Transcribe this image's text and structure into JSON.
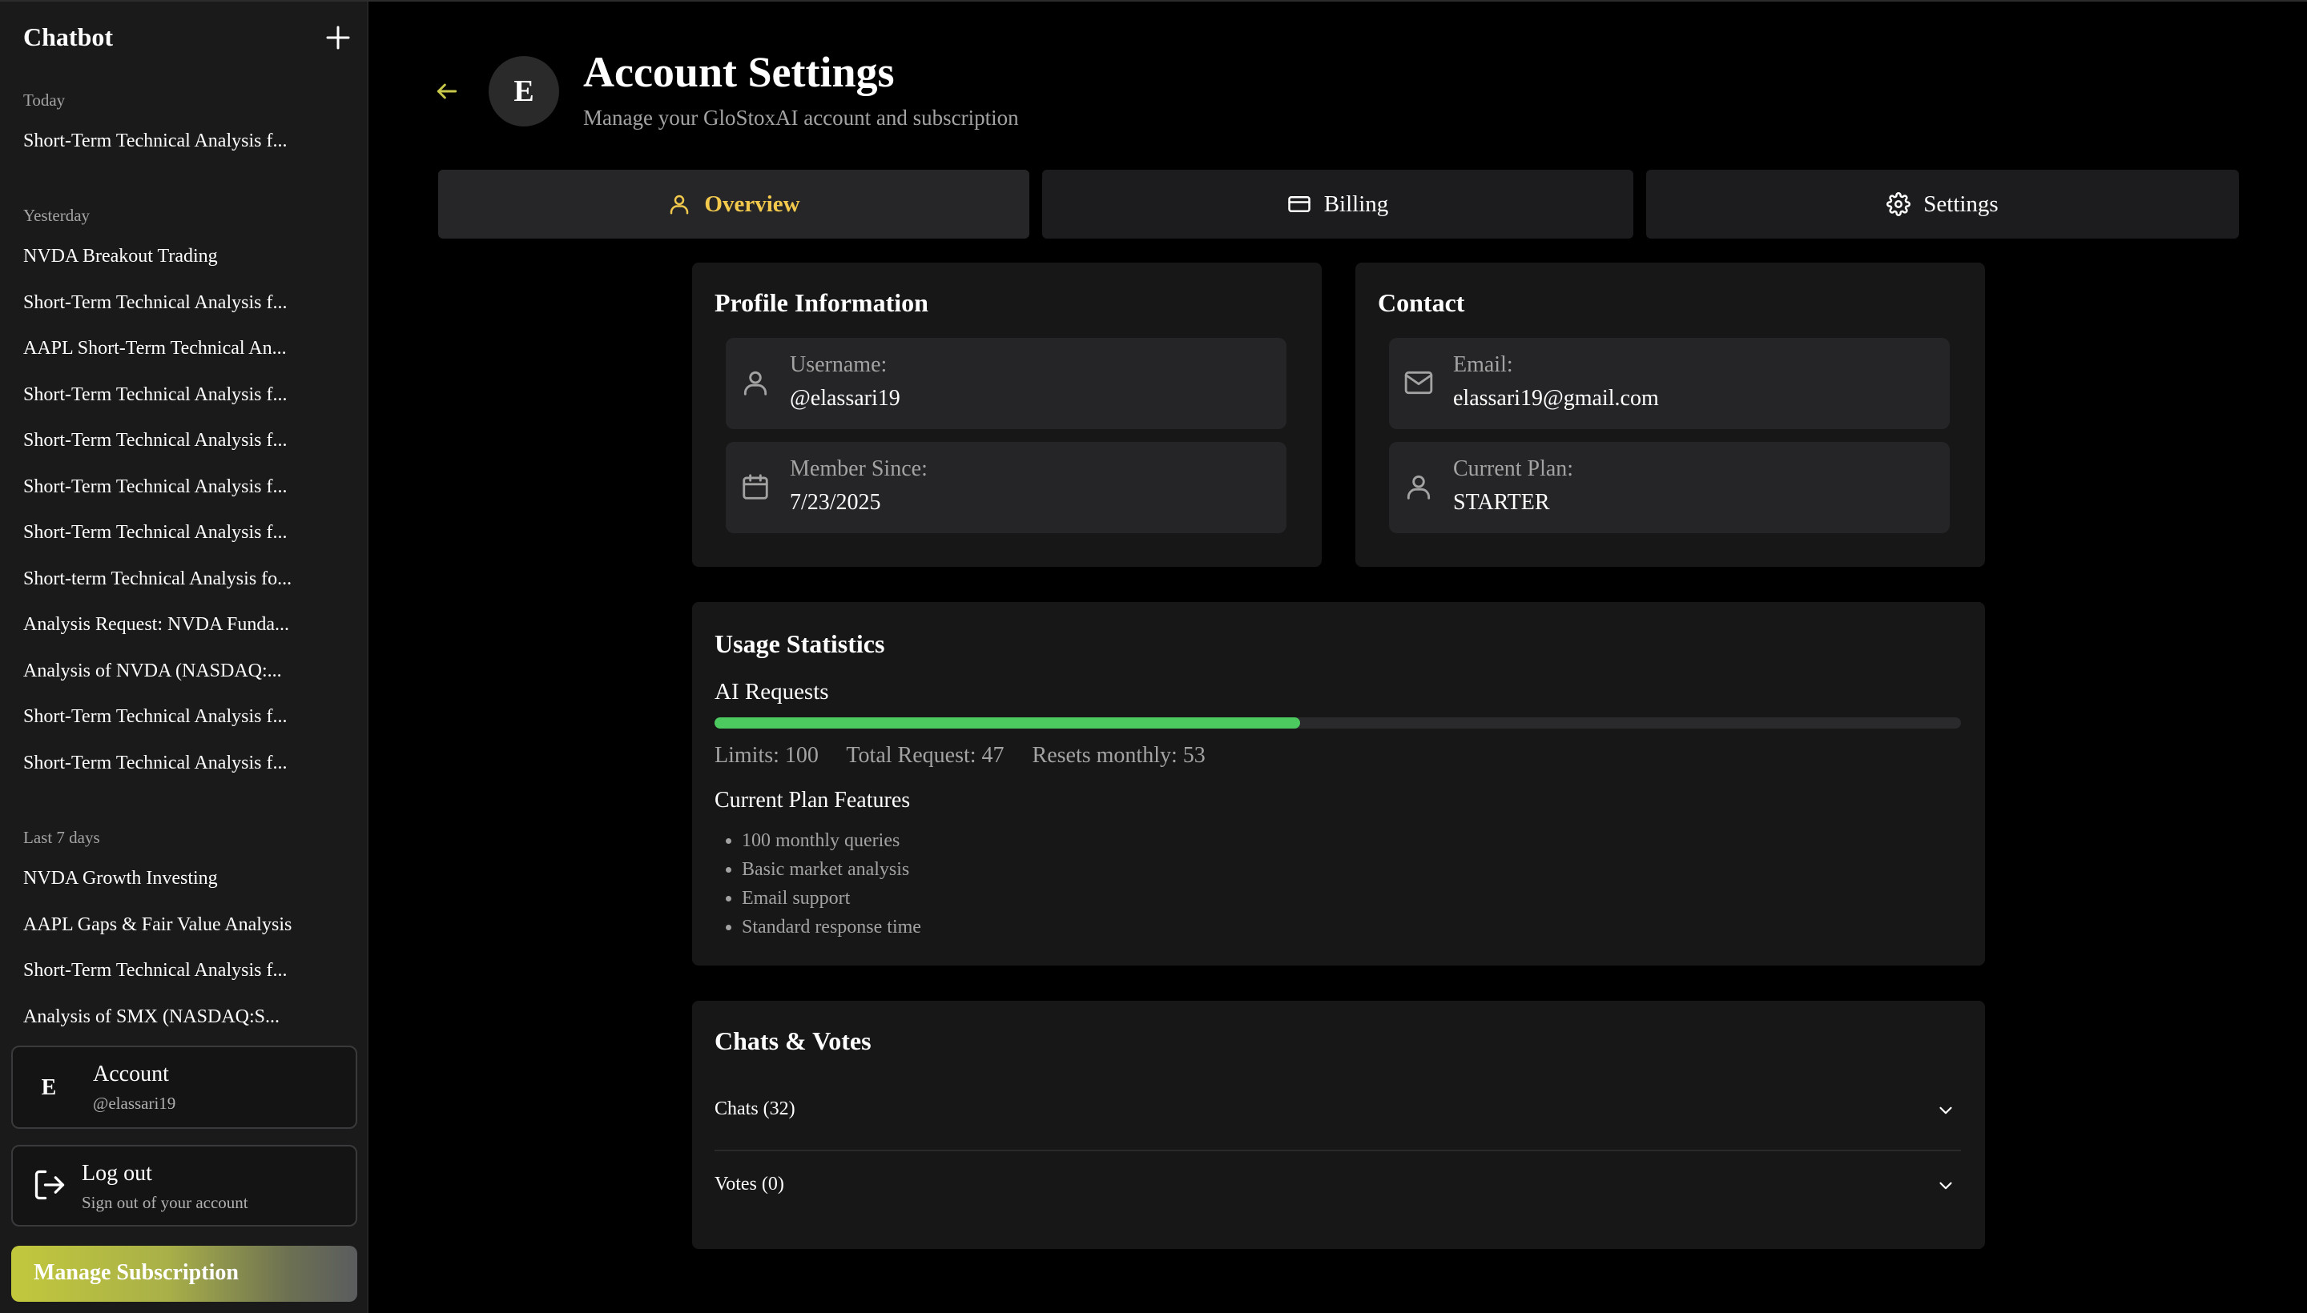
{
  "sidebar": {
    "title": "Chatbot",
    "groups": [
      {
        "label": "Today",
        "items": [
          "Short-Term Technical Analysis f..."
        ]
      },
      {
        "label": "Yesterday",
        "items": [
          "NVDA Breakout Trading",
          "Short-Term Technical Analysis f...",
          "AAPL Short-Term Technical An...",
          "Short-Term Technical Analysis f...",
          "Short-Term Technical Analysis f...",
          "Short-Term Technical Analysis f...",
          "Short-Term Technical Analysis f...",
          "Short-term Technical Analysis fo...",
          "Analysis Request: NVDA Funda...",
          "Analysis of NVDA (NASDAQ:...",
          "Short-Term Technical Analysis f...",
          "Short-Term Technical Analysis f..."
        ]
      },
      {
        "label": "Last 7 days",
        "items": [
          "NVDA Growth Investing",
          "AAPL Gaps & Fair Value Analysis",
          "Short-Term Technical Analysis f...",
          "Analysis of SMX (NASDAQ:S..."
        ]
      }
    ],
    "account": {
      "avatar": "E",
      "label": "Account",
      "handle": "@elassari19"
    },
    "logout": {
      "label": "Log out",
      "sub": "Sign out of your account"
    },
    "manage_label": "Manage Subscription"
  },
  "header": {
    "avatar": "E",
    "title": "Account Settings",
    "subtitle": "Manage your GloStoxAI account and subscription"
  },
  "tabs": [
    {
      "label": "Overview",
      "icon": "user-icon",
      "active": true
    },
    {
      "label": "Billing",
      "icon": "credit-card-icon",
      "active": false
    },
    {
      "label": "Settings",
      "icon": "gear-icon",
      "active": false
    }
  ],
  "profile": {
    "title": "Profile Information",
    "username_label": "Username:",
    "username": "@elassari19",
    "member_label": "Member Since:",
    "member_since": "7/23/2025"
  },
  "contact": {
    "title": "Contact",
    "email_label": "Email:",
    "email": "elassari19@gmail.com",
    "plan_label": "Current Plan:",
    "plan": "STARTER"
  },
  "usage": {
    "title": "Usage Statistics",
    "requests_label": "AI Requests",
    "progress_fraction": 0.47,
    "limits": "Limits: 100",
    "total": "Total Request: 47",
    "resets": "Resets monthly: 53",
    "features_title": "Current Plan Features",
    "features": [
      "100 monthly queries",
      "Basic market analysis",
      "Email support",
      "Standard response time"
    ]
  },
  "chats_votes": {
    "title": "Chats & Votes",
    "chats_label": "Chats (32)",
    "votes_label": "Votes (0)"
  },
  "colors": {
    "accent_yellow": "#f2c94c",
    "progress_green": "#4cc95f",
    "back_arrow": "#c8c84a"
  }
}
